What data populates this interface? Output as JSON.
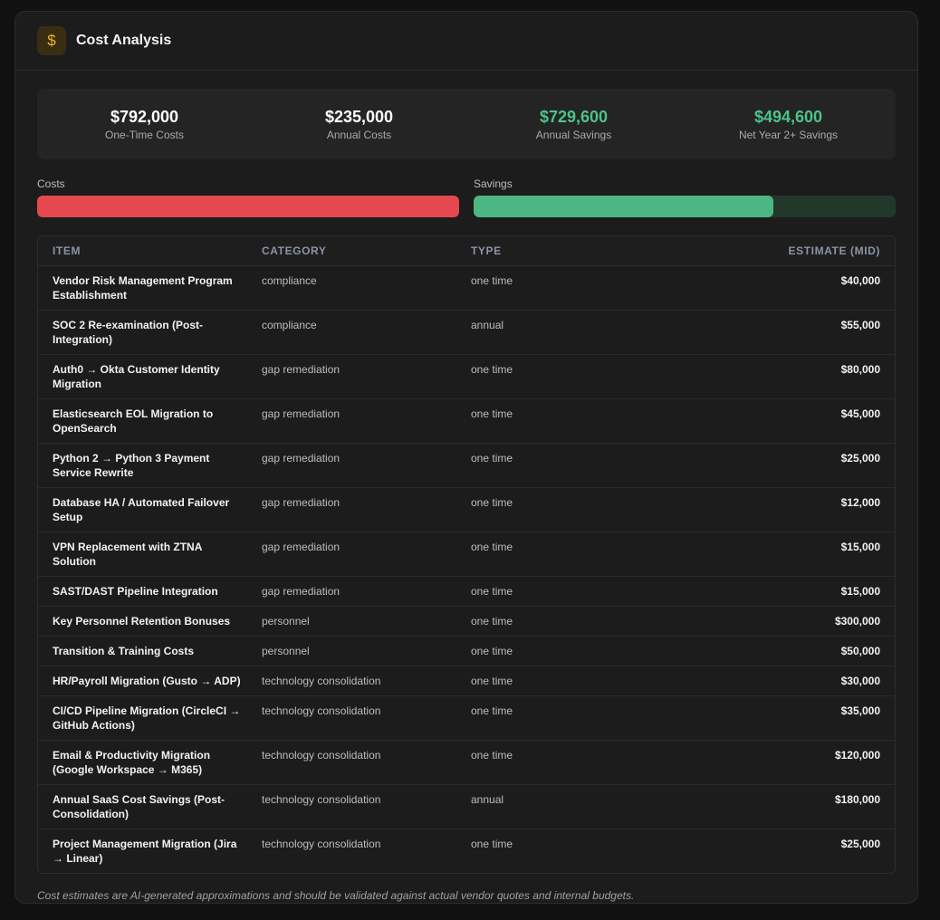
{
  "header": {
    "icon": "dollar-icon",
    "icon_glyph": "$",
    "title": "Cost Analysis"
  },
  "summary": [
    {
      "value": "$792,000",
      "label": "One-Time Costs",
      "color": "#ffffff"
    },
    {
      "value": "$235,000",
      "label": "Annual Costs",
      "color": "#ffffff"
    },
    {
      "value": "$729,600",
      "label": "Annual Savings",
      "color": "#4cc38a"
    },
    {
      "value": "$494,600",
      "label": "Net Year 2+ Savings",
      "color": "#4cc38a"
    }
  ],
  "bars": {
    "costs": {
      "label": "Costs",
      "fraction": 1.0,
      "color": "#e5484d"
    },
    "savings": {
      "label": "Savings",
      "fraction": 0.71,
      "color": "#4cb782"
    }
  },
  "table": {
    "headers": [
      "Item",
      "Category",
      "Type",
      "Estimate (Mid)"
    ],
    "rows": [
      {
        "item": "Vendor Risk Management Program Establishment",
        "category": "compliance",
        "type": "one time",
        "estimate": "$40,000"
      },
      {
        "item": "SOC 2 Re-examination (Post-Integration)",
        "category": "compliance",
        "type": "annual",
        "estimate": "$55,000"
      },
      {
        "item": "Auth0 → Okta Customer Identity Migration",
        "category": "gap remediation",
        "type": "one time",
        "estimate": "$80,000"
      },
      {
        "item": "Elasticsearch EOL Migration to OpenSearch",
        "category": "gap remediation",
        "type": "one time",
        "estimate": "$45,000"
      },
      {
        "item": "Python 2 → Python 3 Payment Service Rewrite",
        "category": "gap remediation",
        "type": "one time",
        "estimate": "$25,000"
      },
      {
        "item": "Database HA / Automated Failover Setup",
        "category": "gap remediation",
        "type": "one time",
        "estimate": "$12,000"
      },
      {
        "item": "VPN Replacement with ZTNA Solution",
        "category": "gap remediation",
        "type": "one time",
        "estimate": "$15,000"
      },
      {
        "item": "SAST/DAST Pipeline Integration",
        "category": "gap remediation",
        "type": "one time",
        "estimate": "$15,000"
      },
      {
        "item": "Key Personnel Retention Bonuses",
        "category": "personnel",
        "type": "one time",
        "estimate": "$300,000"
      },
      {
        "item": "Transition & Training Costs",
        "category": "personnel",
        "type": "one time",
        "estimate": "$50,000"
      },
      {
        "item": "HR/Payroll Migration (Gusto → ADP)",
        "category": "technology consolidation",
        "type": "one time",
        "estimate": "$30,000"
      },
      {
        "item": "CI/CD Pipeline Migration (CircleCI → GitHub Actions)",
        "category": "technology consolidation",
        "type": "one time",
        "estimate": "$35,000"
      },
      {
        "item": "Email & Productivity Migration (Google Workspace → M365)",
        "category": "technology consolidation",
        "type": "one time",
        "estimate": "$120,000"
      },
      {
        "item": "Annual SaaS Cost Savings (Post-Consolidation)",
        "category": "technology consolidation",
        "type": "annual",
        "estimate": "$180,000"
      },
      {
        "item": "Project Management Migration (Jira → Linear)",
        "category": "technology consolidation",
        "type": "one time",
        "estimate": "$25,000"
      }
    ]
  },
  "footnote": "Cost estimates are AI-generated approximations and should be validated against actual vendor quotes and internal budgets."
}
